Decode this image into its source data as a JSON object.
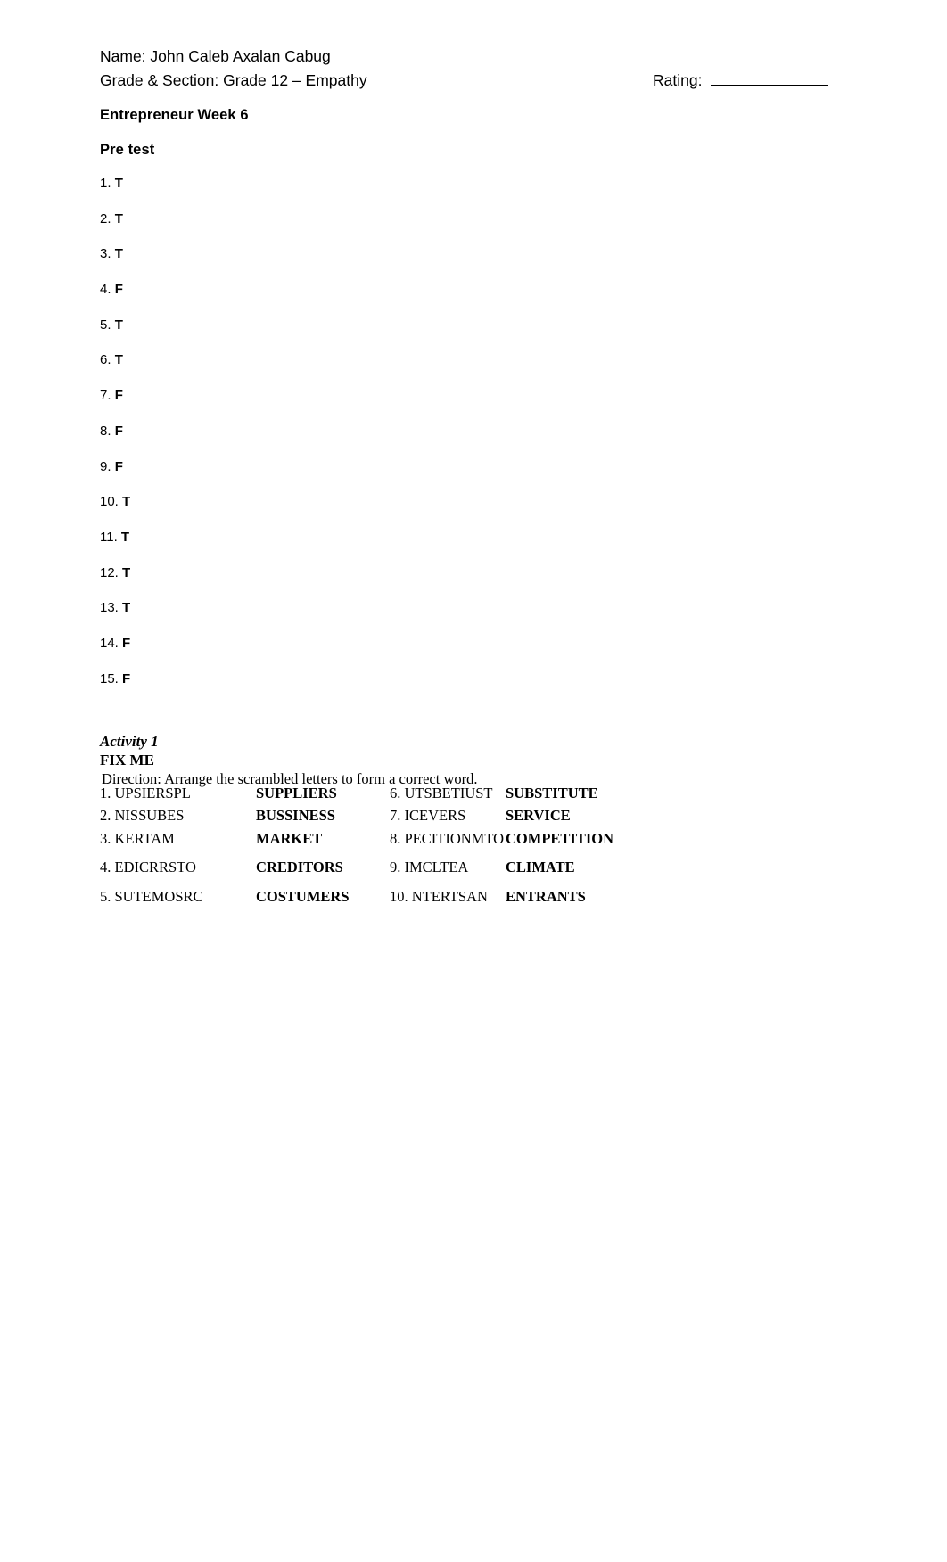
{
  "header": {
    "name_line": "Name: John Caleb Axalan Cabug",
    "grade_line": "Grade & Section: Grade 12 – Empathy",
    "rating_label": "Rating:"
  },
  "titles": {
    "week": "Entrepreneur Week 6",
    "pretest": "Pre test"
  },
  "pretest": [
    {
      "num": "1.",
      "answer": "T"
    },
    {
      "num": "2.",
      "answer": "T"
    },
    {
      "num": "3.",
      "answer": "T"
    },
    {
      "num": "4.",
      "answer": "F"
    },
    {
      "num": "5.",
      "answer": "T"
    },
    {
      "num": "6.",
      "answer": "T"
    },
    {
      "num": "7.",
      "answer": "F"
    },
    {
      "num": "8.",
      "answer": "F"
    },
    {
      "num": "9.",
      "answer": "F"
    },
    {
      "num": "10.",
      "answer": "T"
    },
    {
      "num": "11.",
      "answer": "T"
    },
    {
      "num": "12.",
      "answer": "T"
    },
    {
      "num": "13.",
      "answer": "T"
    },
    {
      "num": "14.",
      "answer": "F"
    },
    {
      "num": "15.",
      "answer": "F"
    }
  ],
  "activity": {
    "label": "Activity 1",
    "name": "FIX ME",
    "direction": "Direction: Arrange the scrambled letters to form a correct word."
  },
  "words": {
    "left": [
      {
        "scrambled": "1. UPSIERSPL",
        "answer": "SUPPLIERS"
      },
      {
        "scrambled": "2. NISSUBES",
        "answer": "BUSSINESS"
      },
      {
        "scrambled": "3. KERTAM",
        "answer": "MARKET"
      },
      {
        "scrambled": "4. EDICRRSTO",
        "answer": "CREDITORS"
      },
      {
        "scrambled": "5. SUTEMOSRC",
        "answer": "COSTUMERS"
      }
    ],
    "right": [
      {
        "scrambled": "6. UTSBETIUST",
        "answer": "SUBSTITUTE"
      },
      {
        "scrambled": "7. ICEVERS",
        "answer": "SERVICE"
      },
      {
        "scrambled": "8. PECITIONMTO",
        "answer": "COMPETITION"
      },
      {
        "scrambled": "9. IMCLTEA",
        "answer": "CLIMATE"
      },
      {
        "scrambled": "10. NTERTSAN",
        "answer": "ENTRANTS"
      }
    ]
  }
}
